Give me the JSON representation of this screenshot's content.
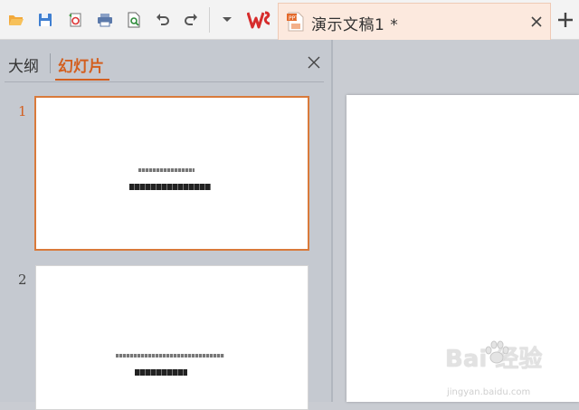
{
  "toolbar": {
    "icons": [
      "open-folder-icon",
      "save-icon",
      "export-pdf-icon",
      "print-icon",
      "print-preview-icon",
      "undo-icon",
      "redo-icon",
      "dropdown-arrow-icon"
    ]
  },
  "app": {
    "logo_icon": "wps-logo-icon"
  },
  "document_tab": {
    "title": "演示文稿1 *",
    "icon": "ppt-file-icon"
  },
  "panel": {
    "tabs": [
      {
        "label": "大纲",
        "active": false
      },
      {
        "label": "幻灯片",
        "active": true
      }
    ]
  },
  "slides": [
    {
      "number": "1",
      "selected": true
    },
    {
      "number": "2",
      "selected": false
    }
  ],
  "watermark": {
    "brand": "Bai 经验",
    "url": "jingyan.baidu.com"
  },
  "colors": {
    "accent": "#d35f1f",
    "tab_bg": "#fce9de",
    "panel_bg": "#c5c9d0"
  }
}
